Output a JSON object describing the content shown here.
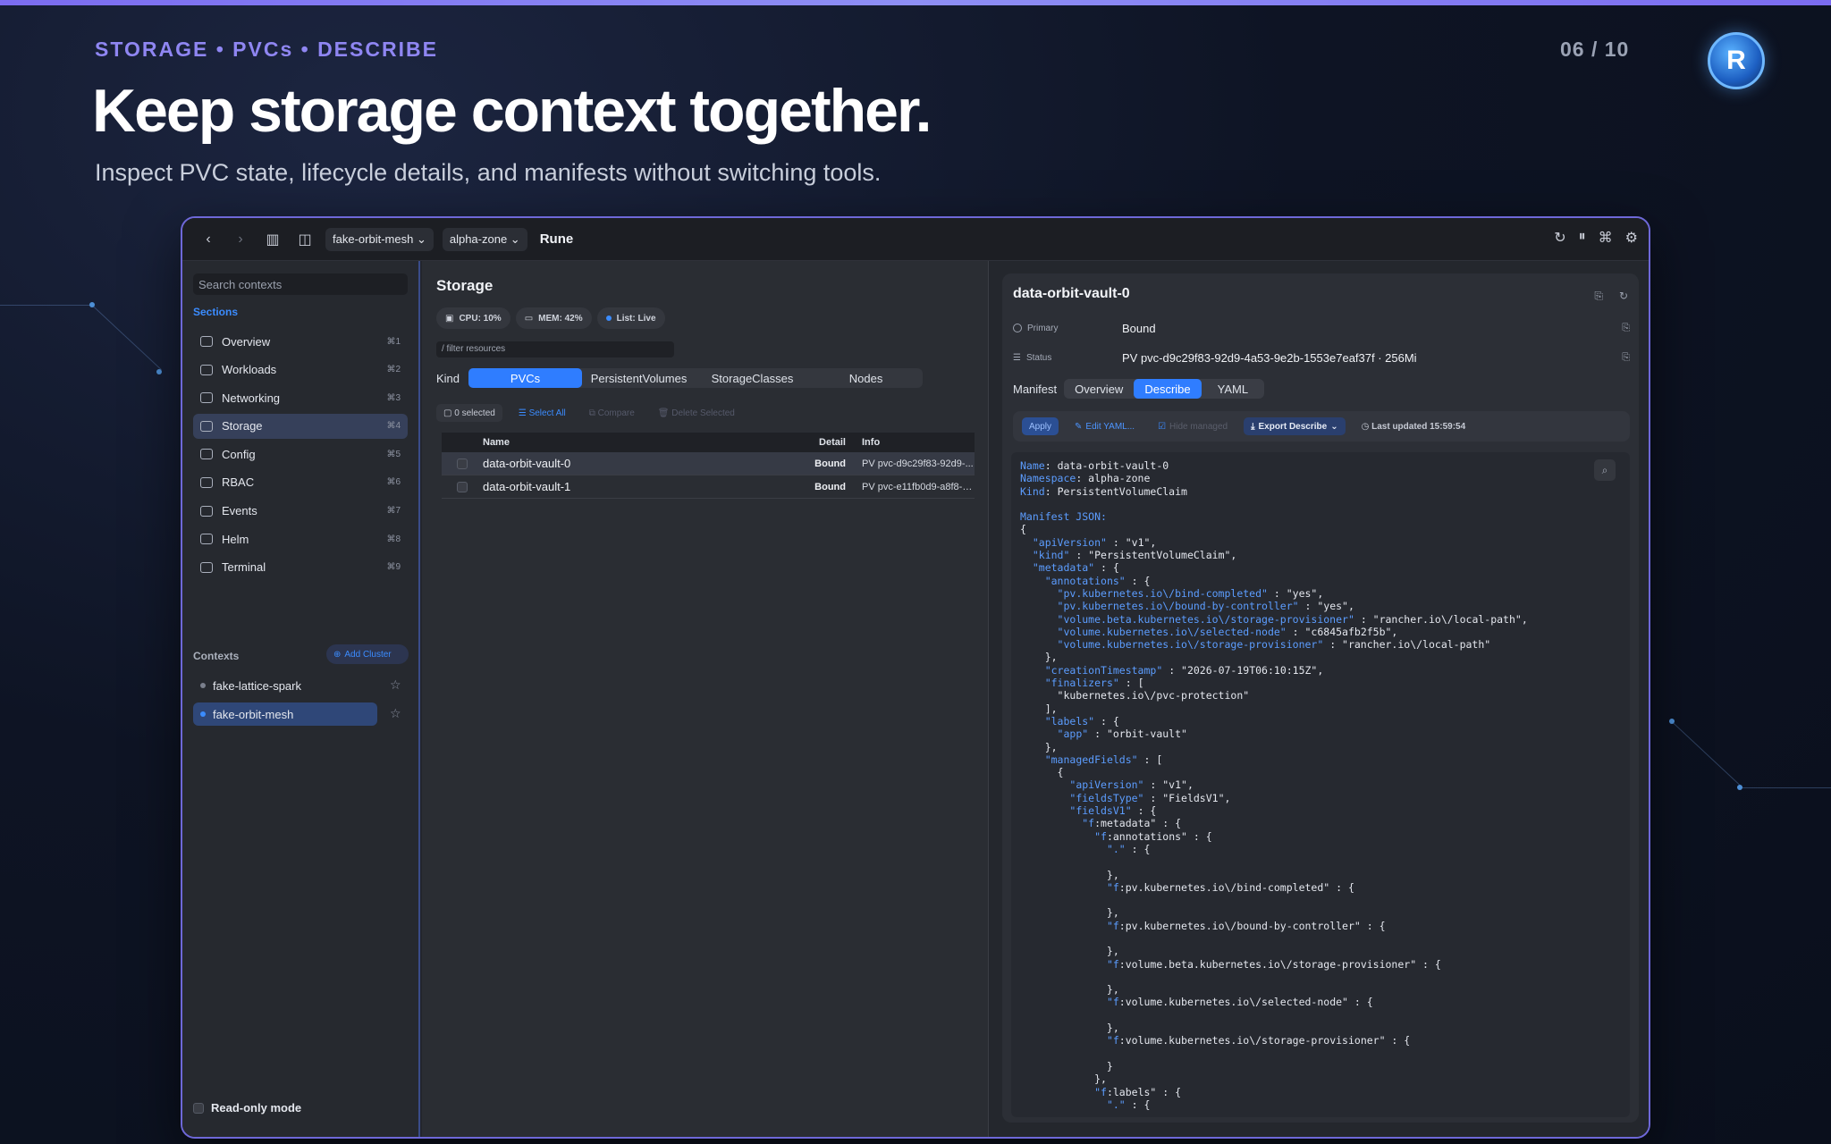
{
  "slide": {
    "eyebrow": "STORAGE • PVCs • DESCRIBE",
    "counter": "06 / 10",
    "headline": "Keep storage context together.",
    "subline": "Inspect PVC state, lifecycle details, and manifests without switching tools.",
    "logo_letter": "R"
  },
  "titlebar": {
    "cluster_select": "fake-orbit-mesh",
    "namespace_select": "alpha-zone",
    "app_title": "Rune"
  },
  "sidebar": {
    "search_placeholder": "Search contexts",
    "sections_label": "Sections",
    "items": [
      {
        "label": "Overview",
        "key": "⌘1",
        "icon": "grid-icon"
      },
      {
        "label": "Workloads",
        "key": "⌘2",
        "icon": "cube-icon"
      },
      {
        "label": "Networking",
        "key": "⌘3",
        "icon": "network-icon"
      },
      {
        "label": "Storage",
        "key": "⌘4",
        "icon": "drive-icon",
        "active": true
      },
      {
        "label": "Config",
        "key": "⌘5",
        "icon": "sliders-icon"
      },
      {
        "label": "RBAC",
        "key": "⌘6",
        "icon": "users-icon"
      },
      {
        "label": "Events",
        "key": "⌘7",
        "icon": "bolt-icon"
      },
      {
        "label": "Helm",
        "key": "⌘8",
        "icon": "helm-icon"
      },
      {
        "label": "Terminal",
        "key": "⌘9",
        "icon": "terminal-icon"
      }
    ],
    "contexts_label": "Contexts",
    "add_cluster_label": "Add Cluster",
    "contexts": [
      {
        "label": "fake-lattice-spark",
        "active": false
      },
      {
        "label": "fake-orbit-mesh",
        "active": true
      }
    ],
    "readonly_label": "Read-only mode"
  },
  "storage": {
    "title": "Storage",
    "pills": {
      "cpu": "CPU: 10%",
      "mem": "MEM: 42%",
      "list": "List: Live"
    },
    "filter_placeholder": "/ filter resources",
    "kind_label": "Kind",
    "kind_tabs": [
      "PVCs",
      "PersistentVolumes",
      "StorageClasses",
      "Nodes"
    ],
    "selected_label": "0 selected",
    "select_all": "Select All",
    "compare": "Compare",
    "delete_selected": "Delete Selected",
    "columns": {
      "name": "Name",
      "detail": "Detail",
      "info": "Info"
    },
    "rows": [
      {
        "name": "data-orbit-vault-0",
        "detail": "Bound",
        "info": "PV pvc-d9c29f83-92d9-..."
      },
      {
        "name": "data-orbit-vault-1",
        "detail": "Bound",
        "info": "PV pvc-e11fb0d9-a8f8-4..."
      }
    ]
  },
  "detail": {
    "title": "data-orbit-vault-0",
    "primary_label": "Primary",
    "primary_value": "Bound",
    "status_label": "Status",
    "status_value": "PV pvc-d9c29f83-92d9-4a53-9e2b-1553e7eaf37f · 256Mi",
    "manifest_label": "Manifest",
    "tabs": [
      "Overview",
      "Describe",
      "YAML"
    ],
    "apply": "Apply",
    "edit_yaml": "Edit YAML...",
    "hide_managed": "Hide managed",
    "export_describe": "Export Describe",
    "last_updated": "Last updated 15:59:54",
    "code": {
      "name": "data-orbit-vault-0",
      "namespace": "alpha-zone",
      "kind": "PersistentVolumeClaim",
      "manifest_label": "Manifest JSON:"
    }
  },
  "colors": {
    "accent": "#2f7dff",
    "eyebrow": "#8f86f2",
    "border": "#6e68d8"
  }
}
